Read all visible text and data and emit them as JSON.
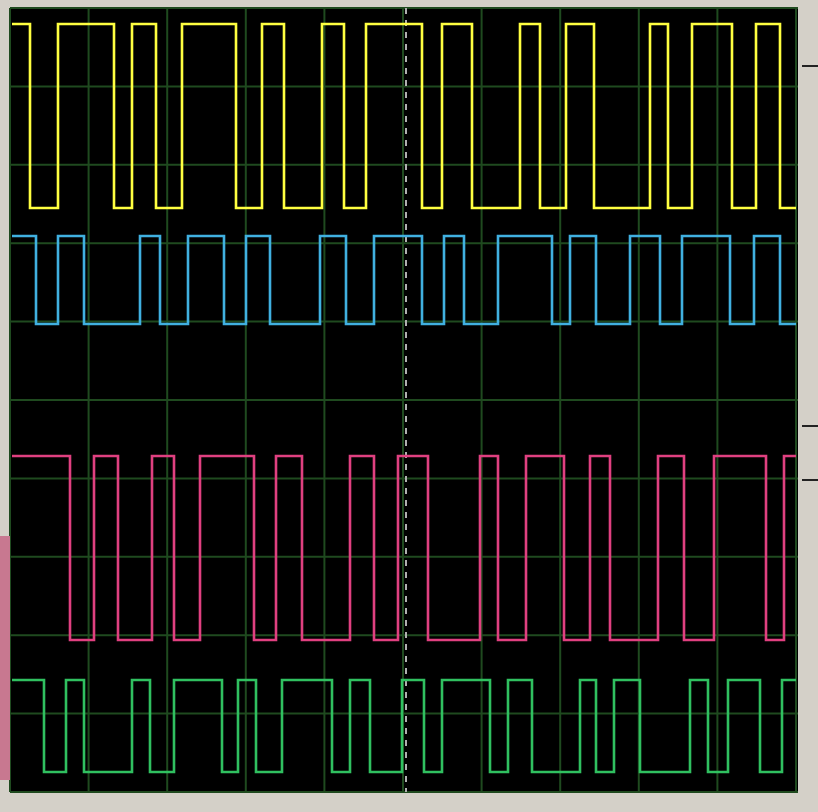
{
  "traces": [
    {
      "color": "#ffff40"
    },
    {
      "color": "#40b0e0"
    },
    {
      "color": "#e04080"
    },
    {
      "color": "#30c060"
    }
  ]
}
